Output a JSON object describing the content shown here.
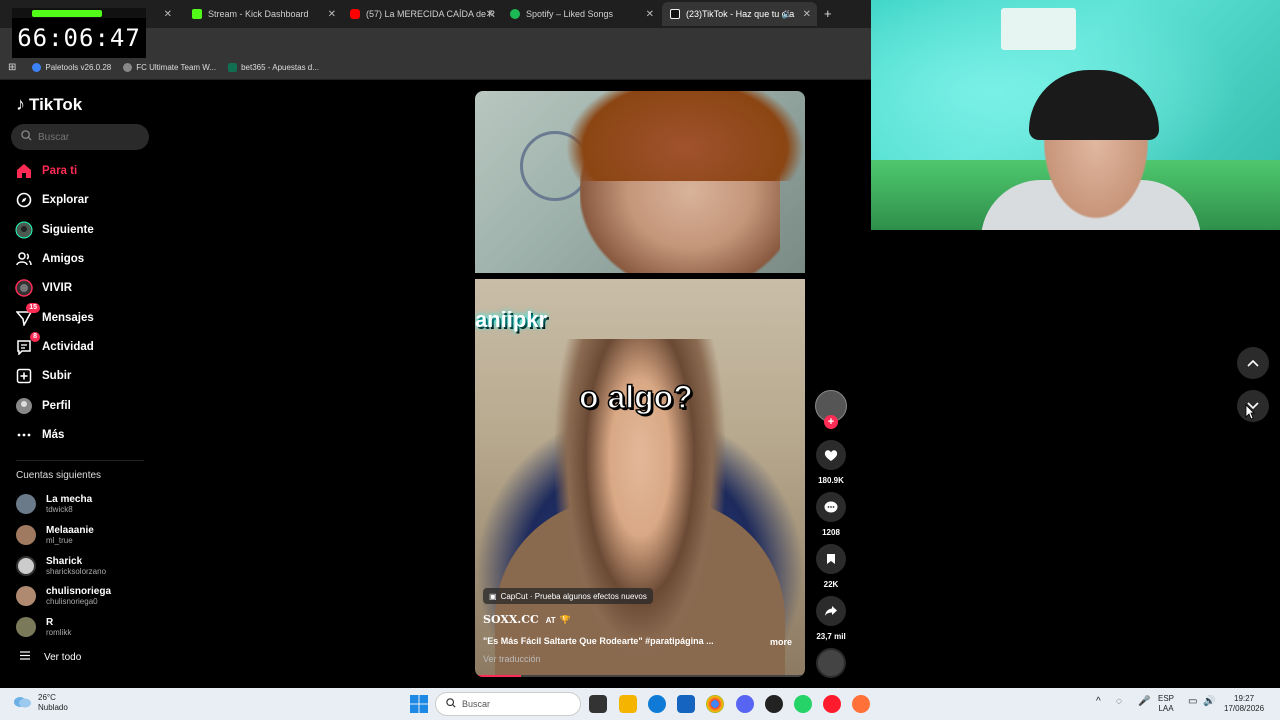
{
  "browser": {
    "tabs": [
      {
        "label": "",
        "color": "#53fc18"
      },
      {
        "label": "Stream - Kick Dashboard",
        "color": "#53fc18"
      },
      {
        "label": "(57) La MERECIDA CAÍDA de R",
        "color": "#ff0000"
      },
      {
        "label": "Spotify – Liked Songs",
        "color": "#1db954"
      },
      {
        "label": "(23)TikTok - Haz que tu día",
        "color": "#ffffff"
      }
    ],
    "new_tab": "+",
    "bookmarks": [
      {
        "label": "Paletools v26.0.28",
        "color": "#3b82f6"
      },
      {
        "label": "FC Ultimate Team W...",
        "color": "#888888"
      },
      {
        "label": "bet365 - Apuestas d...",
        "color": "#126e51"
      }
    ]
  },
  "overlay": {
    "timer": "66:06:47"
  },
  "sidebar": {
    "logo": "TikTok",
    "search_placeholder": "Buscar",
    "nav": [
      {
        "label": "Para ti",
        "icon": "home-icon",
        "active": true
      },
      {
        "label": "Explorar",
        "icon": "compass-icon"
      },
      {
        "label": "Siguiente",
        "icon": "following-avatar-icon"
      },
      {
        "label": "Amigos",
        "icon": "friends-icon"
      },
      {
        "label": "VIVIR",
        "icon": "live-icon"
      },
      {
        "label": "Mensajes",
        "icon": "messages-icon",
        "badge": "15"
      },
      {
        "label": "Actividad",
        "icon": "activity-icon",
        "badge": "8"
      },
      {
        "label": "Subir",
        "icon": "upload-icon"
      },
      {
        "label": "Perfil",
        "icon": "profile-icon"
      },
      {
        "label": "Más",
        "icon": "more-icon"
      }
    ],
    "following_title": "Cuentas siguientes",
    "following": [
      {
        "name": "La mecha",
        "handle": "tdwick8"
      },
      {
        "name": "Melaaanie",
        "handle": "ml_true"
      },
      {
        "name": "Sharick",
        "handle": "sharicksolorzano"
      },
      {
        "name": "chulisnoriega",
        "handle": "chulisnoriega0"
      },
      {
        "name": "R",
        "handle": "romlikk"
      }
    ],
    "see_all": "Ver todo"
  },
  "video": {
    "overlay_text_1": "aniipkr",
    "overlay_text_2": "o algo?",
    "capcut_label": "CapCut · Prueba algunos efectos nuevos",
    "author": "SOXX.CC",
    "author_suffix": "AT",
    "description": "\"Es Más Fácil Saltarte Que Rodearte\" #paratipágina ...",
    "more": "more",
    "translate": "Ver traducción",
    "progress": 0.14
  },
  "actions": {
    "likes": "180.9K",
    "comments": "1208",
    "saves": "22K",
    "shares": "23,7 mil"
  },
  "taskbar": {
    "weather_temp": "26°C",
    "weather_desc": "Nublado",
    "search_placeholder": "Buscar",
    "lang_1": "ESP",
    "lang_2": "LAA",
    "time": "19:27",
    "date": "17/08/2026"
  }
}
